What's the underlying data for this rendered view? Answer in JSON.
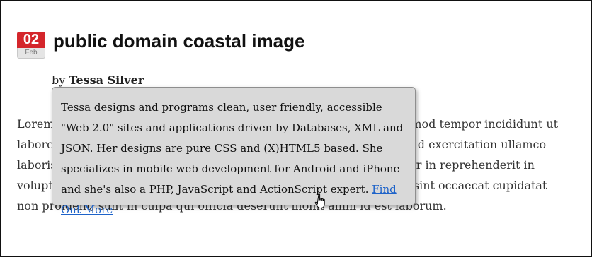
{
  "post": {
    "date": {
      "day": "02",
      "month": "Feb"
    },
    "title": "public domain coastal image",
    "byline": {
      "prefix": "by",
      "author": "Tessa Silver"
    },
    "body_text": "Lorem ipsum dolor sit amet, consectetur adipisicing elit, sed do eiusmod tempor incididunt ut labore et dolore magna aliqua. Ut enim ad minim veniam, quis nostrud exercitation ullamco laboris nisi ut aliquip ex ea commodo consequat. Duis aute irure dolor in reprehenderit in voluptate velit esse cillum dolore eu fugiat nulla pariatur. Excepteur sint occaecat cupidatat non proident, sunt in culpa qui officia deserunt mollit anim id est laborum."
  },
  "tooltip": {
    "text": "Tessa designs and programs clean, user friendly, accessible \"Web 2.0\" sites and applications driven by Databases, XML and JSON. Her designs are pure CSS and (X)HTML5 based. She specializes in mobile web development for Android and iPhone and she's also a PHP, JavaScript and ActionScript expert. ",
    "link_label": "Find Out More"
  },
  "cursor": {
    "icon": "hand-pointer-icon"
  },
  "colors": {
    "date_red": "#d4262b",
    "link": "#1e63c9",
    "tooltip_bg": "#d9d9d9"
  }
}
